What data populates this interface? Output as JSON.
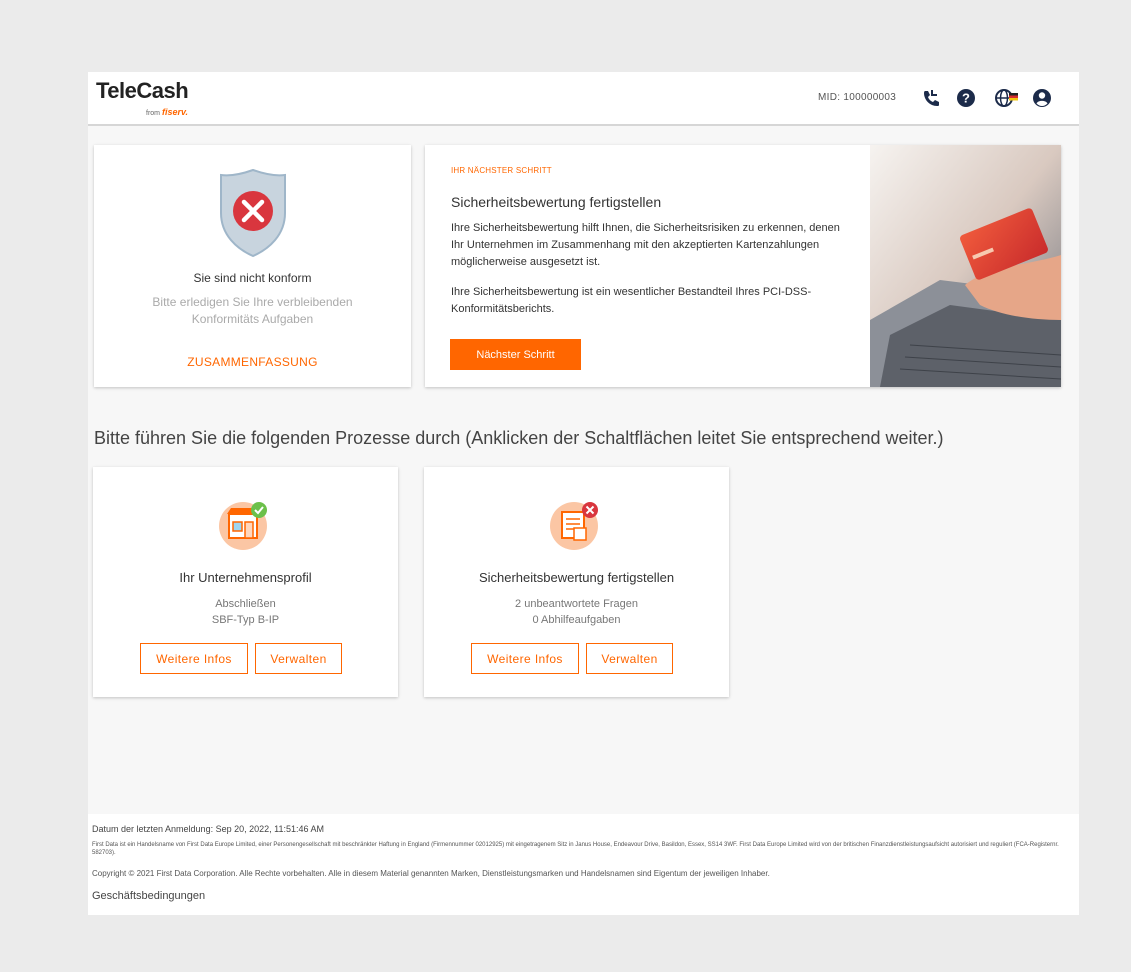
{
  "header": {
    "logo_text": "TeleCash",
    "logo_sub_prefix": "from",
    "logo_sub_brand": "fiserv.",
    "mid": "MID: 100000003",
    "icons": [
      "phone-icon",
      "help-icon",
      "language-icon",
      "user-icon"
    ]
  },
  "status_card": {
    "title": "Sie sind nicht konform",
    "text": "Bitte erledigen Sie Ihre verbleibenden Konformitäts Aufgaben",
    "link": "ZUSAMMENFASSUNG"
  },
  "next_step": {
    "label": "IHR NÄCHSTER SCHRITT",
    "title": "Sicherheitsbewertung fertigstellen",
    "para1": "Ihre Sicherheitsbewertung hilft Ihnen, die Sicherheitsrisiken zu erkennen, denen Ihr Unternehmen im Zusammenhang mit den akzeptierten Kartenzahlungen möglicherweise ausgesetzt ist.",
    "para2": "Ihre Sicherheitsbewertung ist ein wesentlicher Bestandteil Ihres PCI-DSS-Konformitätsberichts.",
    "button": "Nächster Schritt"
  },
  "instructions": "Bitte führen Sie die folgenden Prozesse durch (Anklicken der Schaltflächen leitet Sie entsprechend weiter.)",
  "processes": [
    {
      "title": "Ihr Unternehmensprofil",
      "line1": "Abschließen",
      "line2": "SBF-Typ B-IP",
      "btn_info": "Weitere Infos",
      "btn_manage": "Verwalten"
    },
    {
      "title": "Sicherheitsbewertung fertigstellen",
      "line1": "2 unbeantwortete Fragen",
      "line2": "0 Abhilfeaufgaben",
      "btn_info": "Weitere Infos",
      "btn_manage": "Verwalten"
    }
  ],
  "footer": {
    "last_login": "Datum der letzten Anmeldung: Sep 20, 2022, 11:51:46 AM",
    "legal": "First Data ist ein Handelsname von First Data Europe Limited, einer Personengesellschaft mit beschränkter Haftung in England (Firmennummer 02012925) mit eingetragenem Sitz in Janus House, Endeavour Drive, Basildon, Essex, SS14 3WF. First Data Europe Limited wird von der britischen Finanzdienstleistungsaufsicht autorisiert und reguliert (FCA-Registernr. 582703).",
    "copyright": "Copyright © 2021 First Data Corporation. Alle Rechte vorbehalten. Alle in diesem Material genannten Marken, Dienstleistungsmarken und Handelsnamen sind Eigentum der jeweiligen Inhaber.",
    "terms": "Geschäftsbedingungen"
  },
  "colors": {
    "accent": "#ff6600",
    "error": "#d9363e",
    "success": "#6cc04a",
    "shield": "#c8d4de"
  }
}
